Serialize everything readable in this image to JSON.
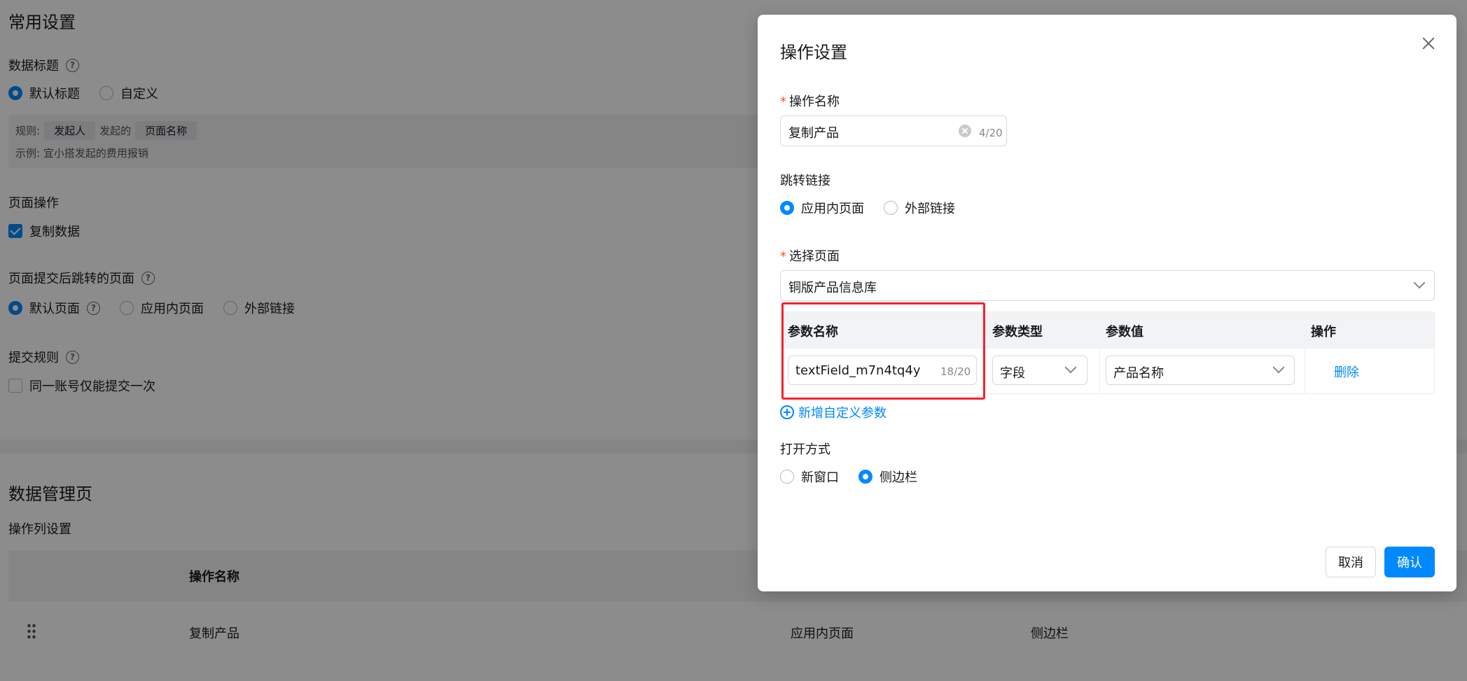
{
  "background": {
    "section_title": "常用设置",
    "data_title": {
      "label": "数据标题",
      "options": [
        "默认标题",
        "自定义"
      ],
      "selected": "默认标题"
    },
    "rule": {
      "prefix": "规则:",
      "tag1": "发起人",
      "middle": "发起的",
      "tag2": "页面名称",
      "example": "示例: 宜小搭发起的费用报销"
    },
    "page_ops": {
      "label": "页面操作",
      "copy_data": "复制数据",
      "copy_checked": true
    },
    "redirect": {
      "label": "页面提交后跳转的页面",
      "options": [
        "默认页面",
        "应用内页面",
        "外部链接"
      ],
      "selected": "默认页面"
    },
    "submit_rule": {
      "label": "提交规则",
      "once": "同一账号仅能提交一次",
      "once_checked": false
    },
    "manage_title": "数据管理页",
    "op_col_label": "操作列设置",
    "table": {
      "header_name": "操作名称",
      "row": {
        "name": "复制产品",
        "link_type": "应用内页面",
        "open_mode": "侧边栏"
      }
    }
  },
  "dialog": {
    "title": "操作设置",
    "op_name": {
      "label": "操作名称",
      "required": true,
      "value": "复制产品",
      "count": "4/20"
    },
    "jump_link": {
      "label": "跳转链接",
      "options": [
        "应用内页面",
        "外部链接"
      ],
      "selected": "应用内页面"
    },
    "select_page": {
      "label": "选择页面",
      "required": true,
      "value": "铜版产品信息库"
    },
    "params_table": {
      "headers": [
        "参数名称",
        "参数类型",
        "参数值",
        "操作"
      ],
      "row": {
        "name": "textField_m7n4tq4y",
        "name_count": "18/20",
        "type": "字段",
        "value": "产品名称",
        "action": "删除"
      }
    },
    "add_param": "新增自定义参数",
    "open_mode": {
      "label": "打开方式",
      "options": [
        "新窗口",
        "侧边栏"
      ],
      "selected": "侧边栏"
    },
    "cancel": "取消",
    "confirm": "确认"
  },
  "colors": {
    "primary": "#0089ff",
    "highlight": "#f5222d",
    "overlay": "rgba(0,0,0,0.45)"
  }
}
